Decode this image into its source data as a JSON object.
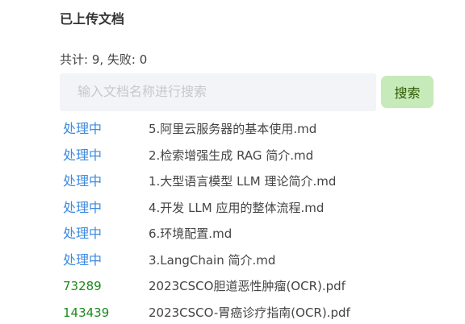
{
  "title": "已上传文档",
  "stats": "共计: 9, 失败: 0",
  "search": {
    "placeholder": "输入文档名称进行搜索",
    "value": "",
    "button_label": "搜索"
  },
  "colors": {
    "processing": "#3d8be0",
    "done": "#1a8a1a",
    "button_bg": "#c6eab9"
  },
  "documents": [
    {
      "status": "处理中",
      "name": "5.阿里云服务器的基本使用.md"
    },
    {
      "status": "处理中",
      "name": "2.检索增强生成 RAG 简介.md"
    },
    {
      "status": "处理中",
      "name": "1.大型语言模型 LLM 理论简介.md"
    },
    {
      "status": "处理中",
      "name": "4.开发 LLM 应用的整体流程.md"
    },
    {
      "status": "处理中",
      "name": "6.环境配置.md"
    },
    {
      "status": "处理中",
      "name": "3.LangChain 简介.md"
    },
    {
      "status": "73289",
      "name": "2023CSCO胆道恶性肿瘤(OCR).pdf"
    },
    {
      "status": "143439",
      "name": "2023CSCO-胃癌诊疗指南(OCR).pdf"
    }
  ]
}
